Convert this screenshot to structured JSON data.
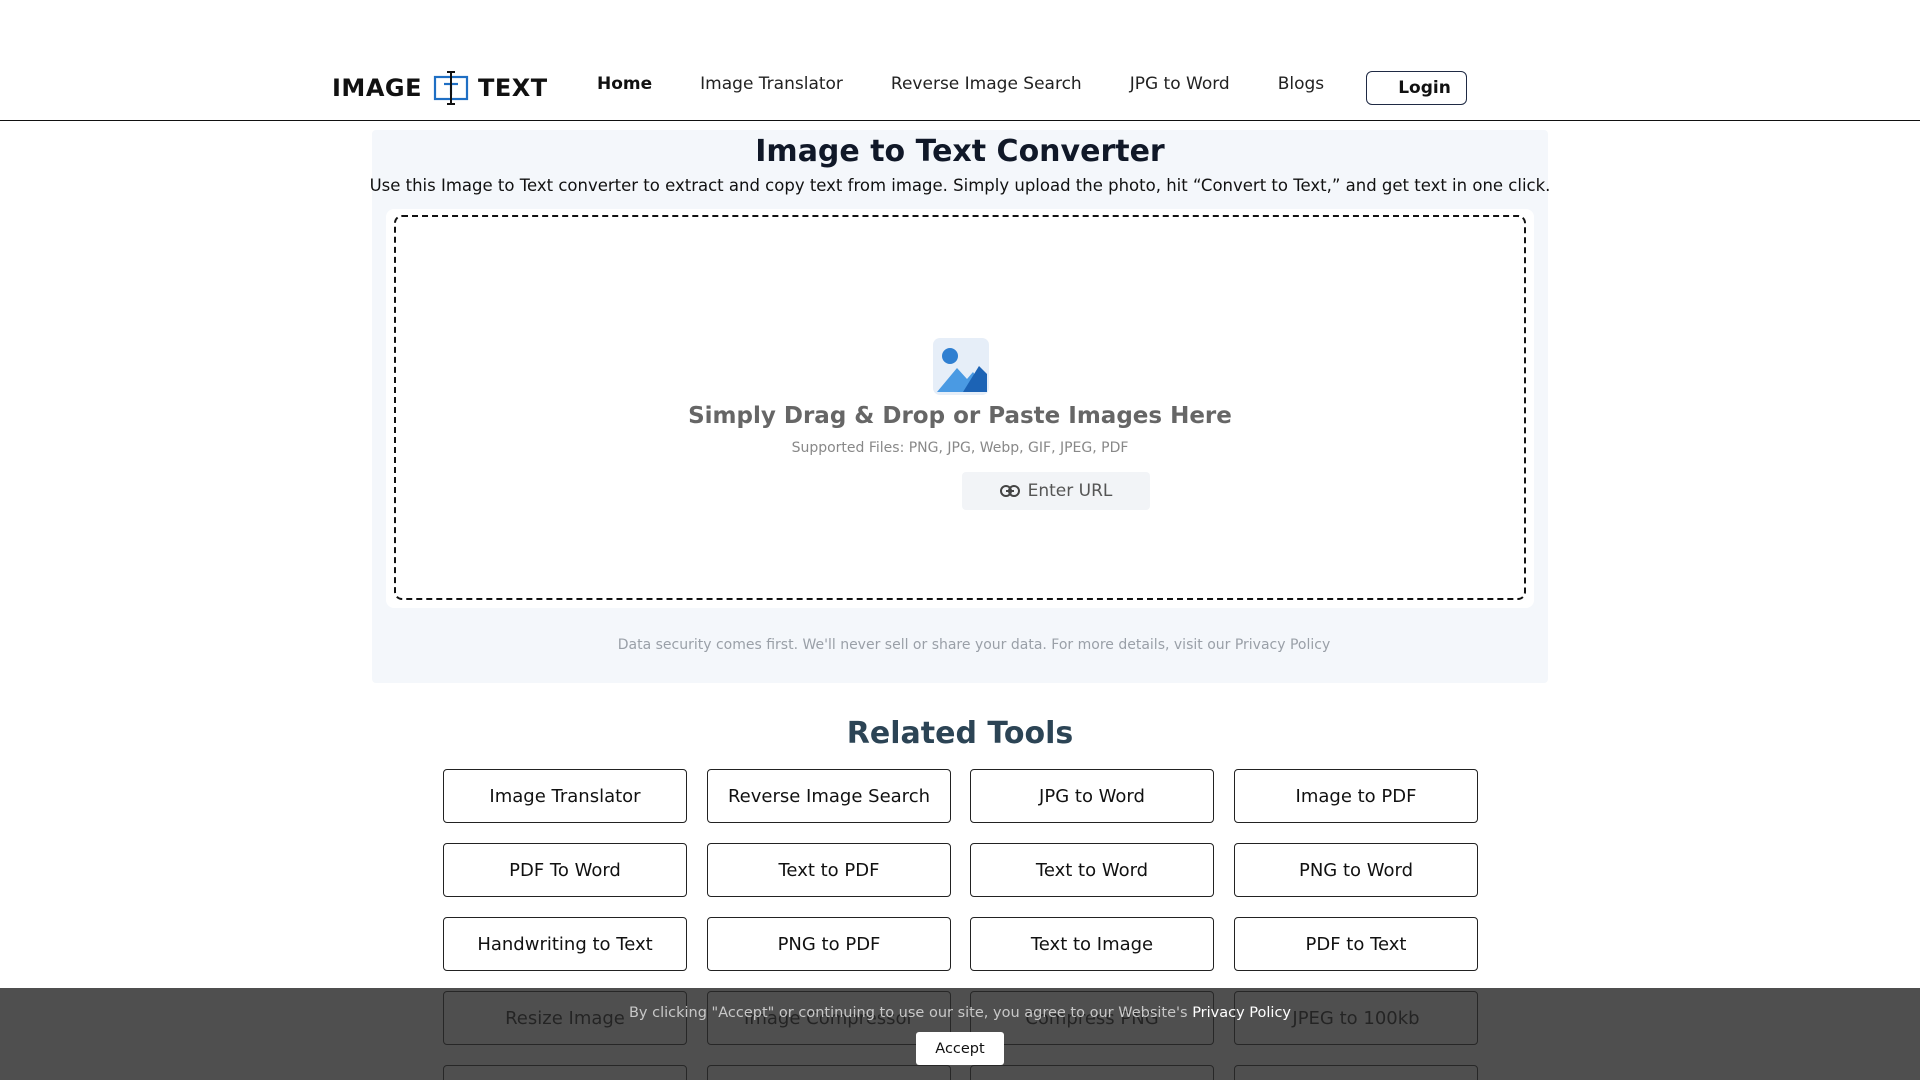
{
  "header": {
    "logo_left": "IMAGE",
    "logo_right": "TEXT",
    "nav": [
      {
        "label": "Home",
        "active": true
      },
      {
        "label": "Image Translator",
        "active": false
      },
      {
        "label": "Reverse Image Search",
        "active": false
      },
      {
        "label": "JPG to Word",
        "active": false
      },
      {
        "label": "Blogs",
        "active": false
      }
    ],
    "login_label": "Login"
  },
  "converter": {
    "title": "Image to Text Converter",
    "subtitle": "Use this Image to Text converter to extract and copy text from image. Simply upload the photo, hit “Convert to Text,” and get text in one click.",
    "drop_text": "Simply Drag & Drop or Paste Images Here",
    "supported": "Supported Files: PNG, JPG, Webp, GIF, JPEG, PDF",
    "url_label": "Enter URL",
    "security": "Data security comes first. We'll never sell or share your data. For more details, visit our Privacy Policy"
  },
  "related": {
    "title": "Related Tools",
    "tools": [
      "Image Translator",
      "Reverse Image Search",
      "JPG to Word",
      "Image to PDF",
      "PDF To Word",
      "Text to PDF",
      "Text to Word",
      "PNG to Word",
      "Handwriting to Text",
      "PNG to PDF",
      "Text to Image",
      "PDF to Text",
      "Resize Image",
      "Image Compressor",
      "Compress PNG",
      "JPEG to 100kb"
    ]
  },
  "cookie": {
    "text": "By clicking \"Accept\" or continuing to use our site, you agree to our Website's",
    "link": "Privacy Policy",
    "accept_label": "Accept"
  },
  "colors": {
    "accent": "#1f6fc4",
    "panel_bg": "#f4f7fb",
    "related_title": "#2c4455"
  },
  "icons": [
    "image-icon",
    "link-icon",
    "logo-text-cursor-icon"
  ]
}
